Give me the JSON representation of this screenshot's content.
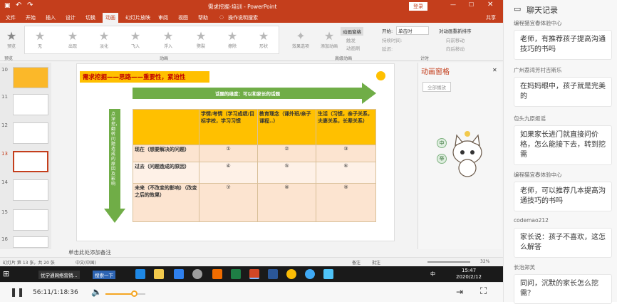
{
  "window": {
    "title": "需求挖掘-培训 - PowerPoint",
    "login": "登录"
  },
  "tabs": [
    "文件",
    "开始",
    "插入",
    "设计",
    "切换",
    "动画",
    "幻灯片放映",
    "审阅",
    "视图",
    "帮助"
  ],
  "tell_me": "操作说明搜索",
  "share": "共享",
  "ribbon": {
    "preview": "预览",
    "effects": [
      "无",
      "出现",
      "淡化",
      "飞入",
      "浮入",
      "劈裂",
      "擦除",
      "形状"
    ],
    "effect_options": "效果选项",
    "add_animation": "添加动画",
    "anim_pane": "动画窗格",
    "trigger": "触发",
    "anim_painter": "动画刷",
    "start_label": "开始:",
    "start_value": "单击时",
    "duration_label": "持续时间:",
    "delay_label": "延迟:",
    "reorder": "对动画重新排序",
    "move_earlier": "向前移动",
    "move_later": "向后移动",
    "groups": [
      "预览",
      "动画",
      "高级动画",
      "计时"
    ]
  },
  "thumbs": [
    "10",
    "11",
    "12",
    "13",
    "14",
    "15",
    "16"
  ],
  "slide": {
    "title": "需求挖掘——思路——重要性，紧迫性",
    "top_arrow": "话题的维度：可以和家长的话题",
    "side_arrow": "点深挖，翻转问题造成的原因及影响",
    "col_headers": [
      "学情/考情（学习成绩/目标学校，学习习惯",
      "教育理念（课外班/亲子课程..）",
      "生活（习惯，亲子关系，夫妻关系，长辈关系）"
    ],
    "rows": [
      {
        "label": "现在（想要解决的问题）",
        "cells": [
          "①",
          "②",
          "③"
        ]
      },
      {
        "label": "过去（问题造成的原因）",
        "cells": [
          "④",
          "⑤",
          "⑥"
        ]
      },
      {
        "label": "未来（不改变的影响）（改变之后的效果）",
        "cells": [
          "⑦",
          "⑧",
          "⑨"
        ]
      }
    ],
    "notes": "单击此处添加备注"
  },
  "anim_pane": {
    "title": "动画窗格",
    "play_all": "全部播放",
    "tags": [
      "中",
      "举"
    ]
  },
  "status": {
    "slide_info": "幻灯片 第 13 张，共 20 张",
    "lang": "中文(中国)",
    "notes": "备注",
    "comments": "批注",
    "zoom": "32%"
  },
  "taskbar": {
    "app1": "优学通网络营销...",
    "app2": "搜索一下",
    "time": "15:47",
    "date": "2020/2/12",
    "ime": "中"
  },
  "player": {
    "time": "56:11/1:18:36",
    "progress": 0.72
  },
  "chat": {
    "title": "聊天记录",
    "messages": [
      {
        "sender": "编程猫宜春体验中心",
        "text": "老师，有推荐孩子提高沟通技巧的书吗"
      },
      {
        "sender": "广州荔湾芳村吉斯乐",
        "text": "在妈妈眼中，孩子就是完美的"
      },
      {
        "sender": "包头九原姬谣",
        "text": "如果家长进门就直接问价格，怎么能接下去，转到挖需"
      },
      {
        "sender": "编程猫宜春体验中心",
        "text": "老师，可以推荐几本提高沟通技巧的书吗"
      },
      {
        "sender": "codemao212",
        "text": "家长说：孩子不喜欢，这怎么解答"
      },
      {
        "sender": "长治郑芙",
        "text": "同问，沉默的家长怎么挖需？"
      }
    ]
  }
}
